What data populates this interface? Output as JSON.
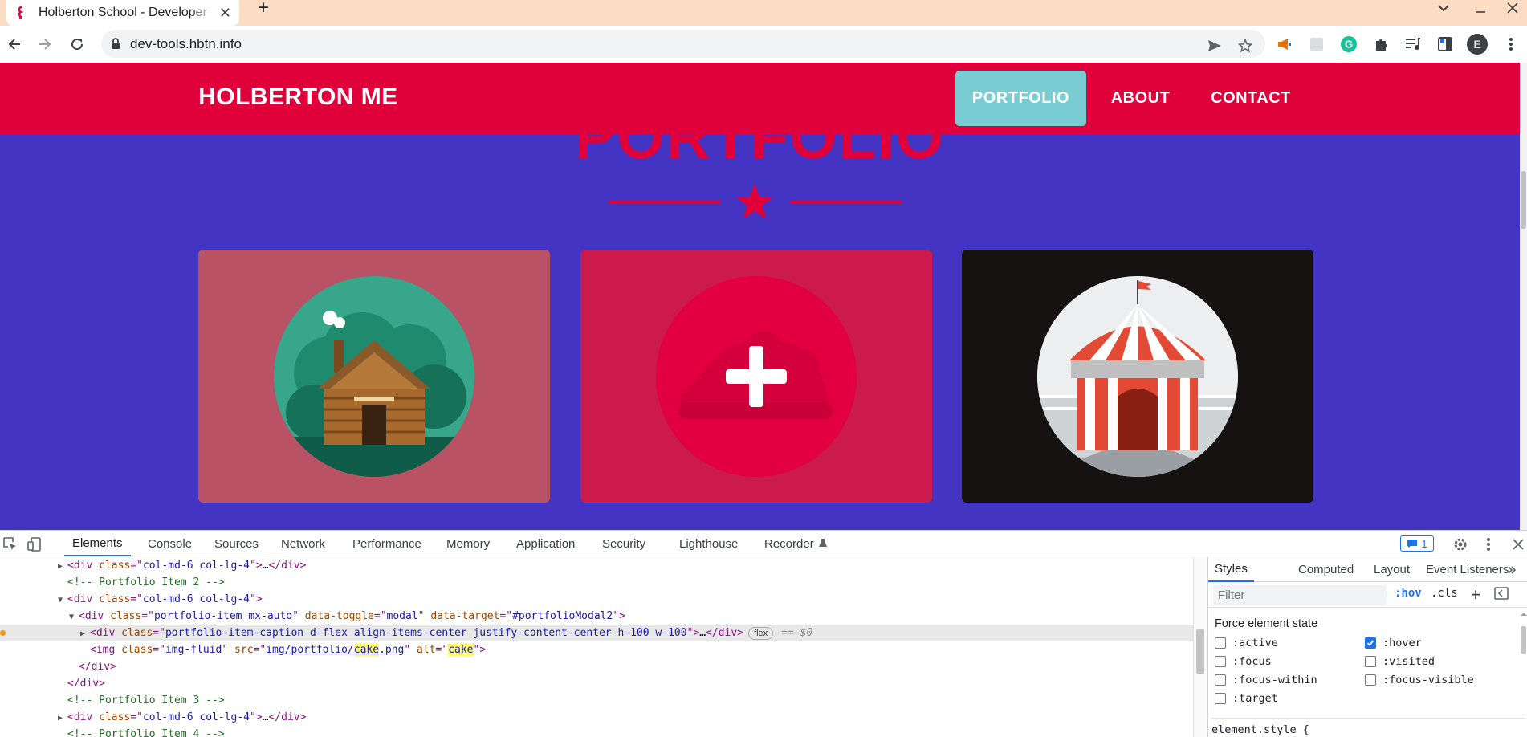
{
  "browser": {
    "tab_title": "Holberton School - Developer",
    "url": "dev-tools.hbtn.info",
    "profile_initial": "E"
  },
  "site": {
    "brand": "HOLBERTON ME",
    "nav": [
      {
        "label": "PORTFOLIO",
        "active": true
      },
      {
        "label": "ABOUT",
        "active": false
      },
      {
        "label": "CONTACT",
        "active": false
      }
    ],
    "section_title": "PORTFOLIO",
    "cards": [
      {
        "name": "cabin",
        "bg": "#b85264"
      },
      {
        "name": "cake",
        "bg": "#cb1a4b",
        "hovered": true
      },
      {
        "name": "circus",
        "bg": "#151211"
      }
    ],
    "colors": {
      "primary": "#e0003a",
      "background": "#4434c4",
      "teal": "#78ccd2"
    }
  },
  "devtools": {
    "tabs": [
      "Elements",
      "Console",
      "Sources",
      "Network",
      "Performance",
      "Memory",
      "Application",
      "Security",
      "Lighthouse",
      "Recorder"
    ],
    "active_tab": "Elements",
    "issues_count": "1",
    "dom": {
      "l1_tag": "div",
      "l1_class": "col-md-6 col-lg-4",
      "l1_tail": "…",
      "l2_comment": "<!-- Portfolio Item 2 -->",
      "l3_tag": "div",
      "l3_class": "col-md-6 col-lg-4",
      "l4_tag": "div",
      "l4_class": "portfolio-item mx-auto",
      "l4_toggle": "modal",
      "l4_target": "#portfolioModal2",
      "l5_tag": "div",
      "l5_class": "portfolio-item-caption d-flex align-items-center justify-content-center h-100 w-100",
      "l5_tail": "…",
      "l5_badge": "flex",
      "l5_ref": "== $0",
      "l6_tag": "img",
      "l6_class": "img-fluid",
      "l6_src_pre": "img/portfolio/",
      "l6_src_hl": "cake",
      "l6_src_post": ".png",
      "l6_alt": "cake",
      "l7_close": "</div>",
      "l8_close": "</div>",
      "l9_comment": "<!-- Portfolio Item 3 -->",
      "l10_tag": "div",
      "l10_class": "col-md-6 col-lg-4",
      "l10_tail": "…",
      "l11_comment": "<!-- Portfolio Item 4 -->"
    },
    "styles": {
      "tabs": [
        "Styles",
        "Computed",
        "Layout",
        "Event Listeners"
      ],
      "active_tab": "Styles",
      "filter_placeholder": "Filter",
      "hov": ":hov",
      "cls": ".cls",
      "force_title": "Force element state",
      "states": [
        {
          "label": ":active",
          "checked": false
        },
        {
          "label": ":hover",
          "checked": true
        },
        {
          "label": ":focus",
          "checked": false
        },
        {
          "label": ":visited",
          "checked": false
        },
        {
          "label": ":focus-within",
          "checked": false
        },
        {
          "label": ":focus-visible",
          "checked": false
        },
        {
          "label": ":target",
          "checked": false
        }
      ],
      "element_style": "element.style {"
    }
  }
}
